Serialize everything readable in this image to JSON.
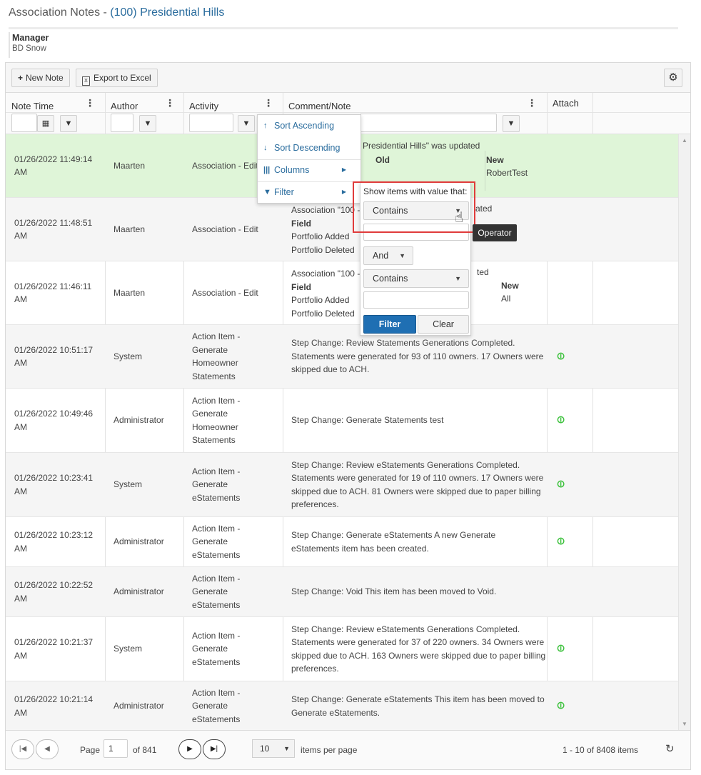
{
  "header": {
    "title_prefix": "Association Notes - ",
    "association": "(100) Presidential Hills",
    "manager_label": "Manager",
    "manager_value": "BD Snow"
  },
  "toolbar": {
    "new_note": "New Note",
    "export_excel": "Export to Excel"
  },
  "columns": [
    "Note Time",
    "Author",
    "Activity",
    "Comment/Note",
    "Attach"
  ],
  "column_menu": {
    "sort_asc": "Sort Ascending",
    "sort_desc": "Sort Descending",
    "columns": "Columns",
    "filter": "Filter"
  },
  "filter_popup": {
    "label": "Show items with value that:",
    "operator1": "Contains",
    "logic": "And",
    "operator2": "Contains",
    "filter_button": "Filter",
    "clear_button": "Clear",
    "tooltip": "Operator"
  },
  "rows": [
    {
      "time": "01/26/2022 11:49:14 AM",
      "author": "Maarten",
      "activity": "Association - Edit",
      "comment": "Presidential Hills\" was updated",
      "detail_old_label": "Old",
      "detail_new_label": "New",
      "detail_new_value": "RobertTest",
      "attach": false
    },
    {
      "time": "01/26/2022 11:48:51 AM",
      "author": "Maarten",
      "activity": "Association - Edit",
      "comment_lines": [
        "Association \"100 -",
        "Field",
        "Portfolio Added",
        "Portfolio Deleted"
      ],
      "tail": "ated",
      "attach": false
    },
    {
      "time": "01/26/2022 11:46:11 AM",
      "author": "Maarten",
      "activity": "Association - Edit",
      "comment_lines": [
        "Association \"100 -",
        "Field",
        "Portfolio Added",
        "Portfolio Deleted"
      ],
      "tail": "ted",
      "new_label": "New",
      "new_value": "All",
      "attach": false
    },
    {
      "time": "01/26/2022 10:51:17 AM",
      "author": "System",
      "activity": "Action Item - Generate Homeowner Statements",
      "comment": "Step Change: Review Statements Generations Completed. Statements were generated for 93 of 110 owners. 17 Owners were skipped due to ACH.",
      "attach": true
    },
    {
      "time": "01/26/2022 10:49:46 AM",
      "author": "Administrator",
      "activity": "Action Item - Generate Homeowner Statements",
      "comment": "Step Change: Generate Statements test",
      "attach": true
    },
    {
      "time": "01/26/2022 10:23:41 AM",
      "author": "System",
      "activity": "Action Item - Generate eStatements",
      "comment": "Step Change: Review eStatements Generations Completed. Statements were generated for 19 of 110 owners. 17 Owners were skipped due to ACH. 81 Owners were skipped due to paper billing preferences.",
      "attach": true
    },
    {
      "time": "01/26/2022 10:23:12 AM",
      "author": "Administrator",
      "activity": "Action Item - Generate eStatements",
      "comment": "Step Change: Generate eStatements A new Generate eStatements item has been created.",
      "attach": true
    },
    {
      "time": "01/26/2022 10:22:52 AM",
      "author": "Administrator",
      "activity": "Action Item - Generate eStatements",
      "comment": "Step Change: Void This item has been moved to Void.",
      "attach": false
    },
    {
      "time": "01/26/2022 10:21:37 AM",
      "author": "System",
      "activity": "Action Item - Generate eStatements",
      "comment": "Step Change: Review eStatements Generations Completed. Statements were generated for 37 of 220 owners. 34 Owners were skipped due to ACH. 163 Owners were skipped due to paper billing preferences.",
      "attach": true
    },
    {
      "time": "01/26/2022 10:21:14 AM",
      "author": "Administrator",
      "activity": "Action Item - Generate eStatements",
      "comment": "Step Change: Generate eStatements This item has been moved to Generate eStatements.",
      "attach": true
    }
  ],
  "pager": {
    "page_label": "Page",
    "page_value": "1",
    "of_pages": "of 841",
    "page_size": "10",
    "items_per_page": "items per page",
    "summary": "1 - 10 of 8408 items"
  },
  "colors": {
    "accent": "#2b6d9e",
    "selected_row": "#dff5d8",
    "primary_button": "#1f6fb3",
    "highlight": "#e03b3b",
    "attach_icon": "#3ec23e"
  }
}
